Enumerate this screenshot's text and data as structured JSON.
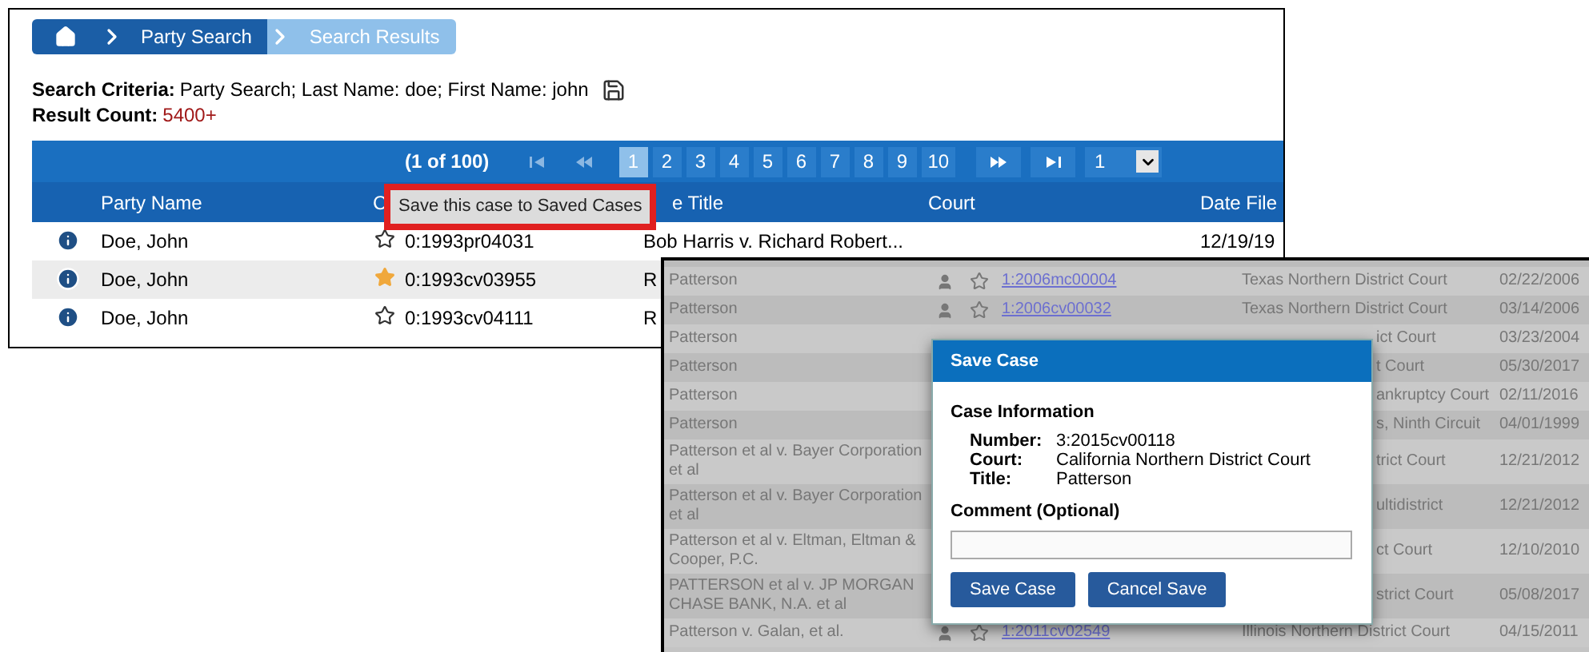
{
  "breadcrumbs": [
    {
      "kind": "home",
      "selected": false
    },
    {
      "kind": "link",
      "label": "Party Search",
      "selected": false
    },
    {
      "kind": "link",
      "label": "Search Results",
      "selected": true
    }
  ],
  "search_criteria": {
    "label": "Search Criteria:",
    "value": "Party Search; Last Name: doe; First Name: john"
  },
  "result_count": {
    "label": "Result Count:",
    "value": "5400+"
  },
  "pagination": {
    "summary": "(1 of 100)",
    "pages": [
      {
        "label": "1",
        "selected": true
      },
      {
        "label": "2",
        "selected": false
      },
      {
        "label": "3",
        "selected": false
      },
      {
        "label": "4",
        "selected": false
      },
      {
        "label": "5",
        "selected": false
      },
      {
        "label": "6",
        "selected": false
      },
      {
        "label": "7",
        "selected": false
      },
      {
        "label": "8",
        "selected": false
      },
      {
        "label": "9",
        "selected": false
      },
      {
        "label": "10",
        "selected": false
      }
    ],
    "page_select": "1"
  },
  "columns": [
    "Party Name",
    "C",
    "e Title",
    "Court",
    "Date File"
  ],
  "tooltip": "Save this case to Saved Cases",
  "rows": [
    {
      "party": "Doe, John",
      "starred": false,
      "case_number": "0:1993pr04031",
      "case_title": "Bob Harris v. Richard Robert...",
      "date_filed": "12/19/19"
    },
    {
      "party": "Doe, John",
      "starred": true,
      "case_number": "0:1993cv03955",
      "case_title": "R"
    },
    {
      "party": "Doe, John",
      "starred": false,
      "case_number": "0:1993cv04111",
      "case_title": "R"
    }
  ],
  "background_rows": [
    {
      "party": "Patterson",
      "link": "1:2006mc00004",
      "court": "Texas Northern District Court",
      "date_filed": "02/22/2006"
    },
    {
      "party": "Patterson",
      "link": "1:2006cv00032",
      "court": "Texas Northern District Court",
      "date_filed": "03/14/2006"
    },
    {
      "party": "Patterson",
      "court": "ict Court",
      "date_filed": "03/23/2004"
    },
    {
      "party": "Patterson",
      "court": "t Court",
      "date_filed": "05/30/2017"
    },
    {
      "party": "Patterson",
      "court": "ankruptcy Court",
      "date_filed": "02/11/2016"
    },
    {
      "party": "Patterson",
      "court": "s, Ninth Circuit",
      "date_filed": "04/01/1999"
    },
    {
      "party": "Patterson et al v. Bayer Corporation et al",
      "court": "trict Court",
      "date_filed": "12/21/2012"
    },
    {
      "party": "Patterson et al v. Bayer Corporation et al",
      "court": "ultidistrict",
      "date_filed": "12/21/2012"
    },
    {
      "party": "Patterson et al v. Eltman, Eltman & Cooper, P.C.",
      "court": "ct Court",
      "date_filed": "12/10/2010"
    },
    {
      "party": "PATTERSON et al v. JP MORGAN CHASE BANK, N.A. et al",
      "court": "strict Court",
      "date_filed": "05/08/2017"
    },
    {
      "party": "Patterson v. Galan, et al.",
      "link": "1:2011cv02549",
      "court": "Illinois Northern District Court",
      "date_filed": "04/15/2011"
    }
  ],
  "modal": {
    "title": "Save Case",
    "section": "Case Information",
    "fields": [
      {
        "label": "Number:",
        "value": "3:2015cv00118"
      },
      {
        "label": "Court:",
        "value": "California Northern District Court"
      },
      {
        "label": "Title:",
        "value": "Patterson"
      }
    ],
    "comment_label": "Comment (Optional)",
    "buttons": [
      "Save Case",
      "Cancel Save"
    ]
  }
}
